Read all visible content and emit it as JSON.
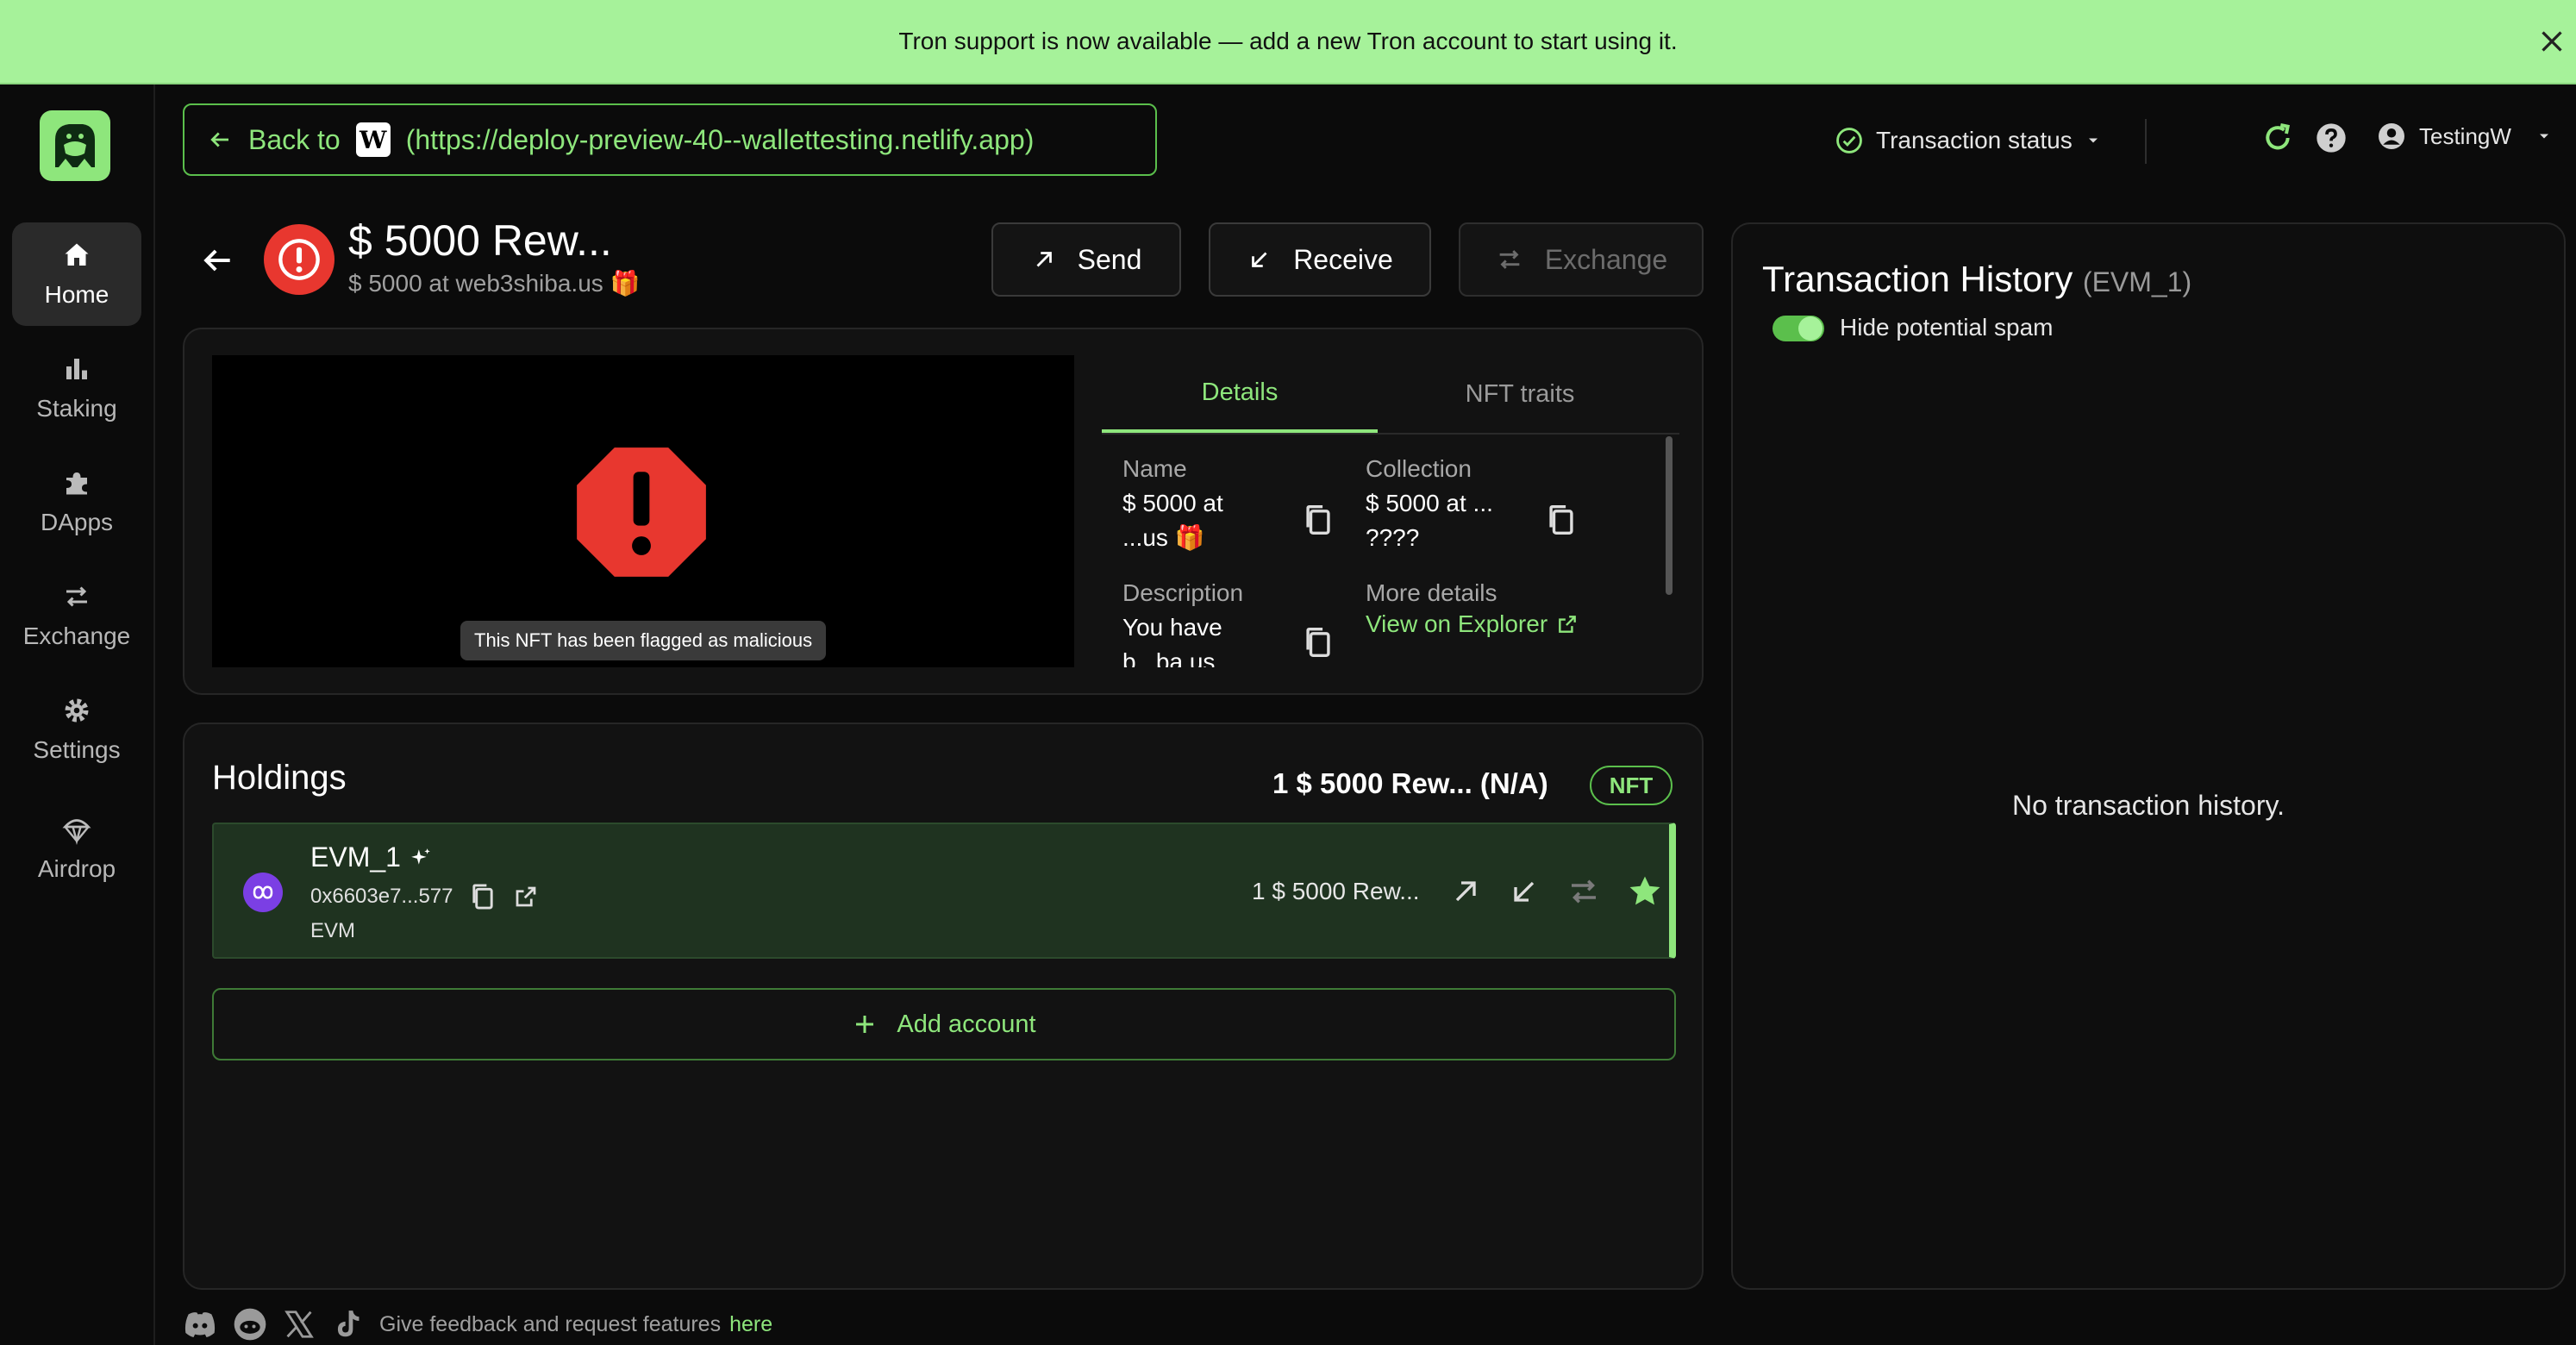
{
  "banner": {
    "text": "Tron support is now available — add a new Tron account to start using it."
  },
  "sidebar": {
    "items": [
      {
        "label": "Home",
        "icon": "home-icon"
      },
      {
        "label": "Staking",
        "icon": "chart-icon"
      },
      {
        "label": "DApps",
        "icon": "puzzle-icon"
      },
      {
        "label": "Exchange",
        "icon": "swap-icon"
      },
      {
        "label": "Settings",
        "icon": "gear-icon"
      },
      {
        "label": "Airdrop",
        "icon": "parachute-icon"
      }
    ]
  },
  "topbar": {
    "back_label": "Back to",
    "site_letter": "W",
    "url": "(https://deploy-preview-40--wallettesting.netlify.app)",
    "tx_status": "Transaction status",
    "user": "TestingW"
  },
  "token": {
    "title": "$ 5000 Rew...",
    "subtitle": "$ 5000 at web3shiba.us 🎁"
  },
  "actions": {
    "send": "Send",
    "receive": "Receive",
    "exchange": "Exchange"
  },
  "nft": {
    "flag_text": "This NFT has been flagged as malicious",
    "tabs": {
      "details": "Details",
      "traits": "NFT traits"
    },
    "name_label": "Name",
    "name_value": "$ 5000 at\n...us 🎁",
    "collection_label": "Collection",
    "collection_value": "$ 5000 at ...\n????",
    "description_label": "Description",
    "description_value": "You have\nb...ba.us",
    "more_label": "More details",
    "explorer_link": "View on Explorer"
  },
  "holdings": {
    "title": "Holdings",
    "summary": "1 $ 5000 Rew... (N/A)",
    "badge": "NFT",
    "account": {
      "name": "EVM_1",
      "address": "0x6603e7...577",
      "type": "EVM",
      "balance": "1 $ 5000 Rew..."
    },
    "add_account": "Add account"
  },
  "history": {
    "title": "Transaction History",
    "account": "(EVM_1)",
    "spam_label": "Hide potential spam",
    "empty": "No transaction history."
  },
  "footer": {
    "text": "Give feedback and request features",
    "link": "here"
  },
  "colors": {
    "accent": "#8ee67c",
    "banner": "#a6f29a",
    "danger": "#e8372f",
    "background": "#0b0b0b"
  }
}
